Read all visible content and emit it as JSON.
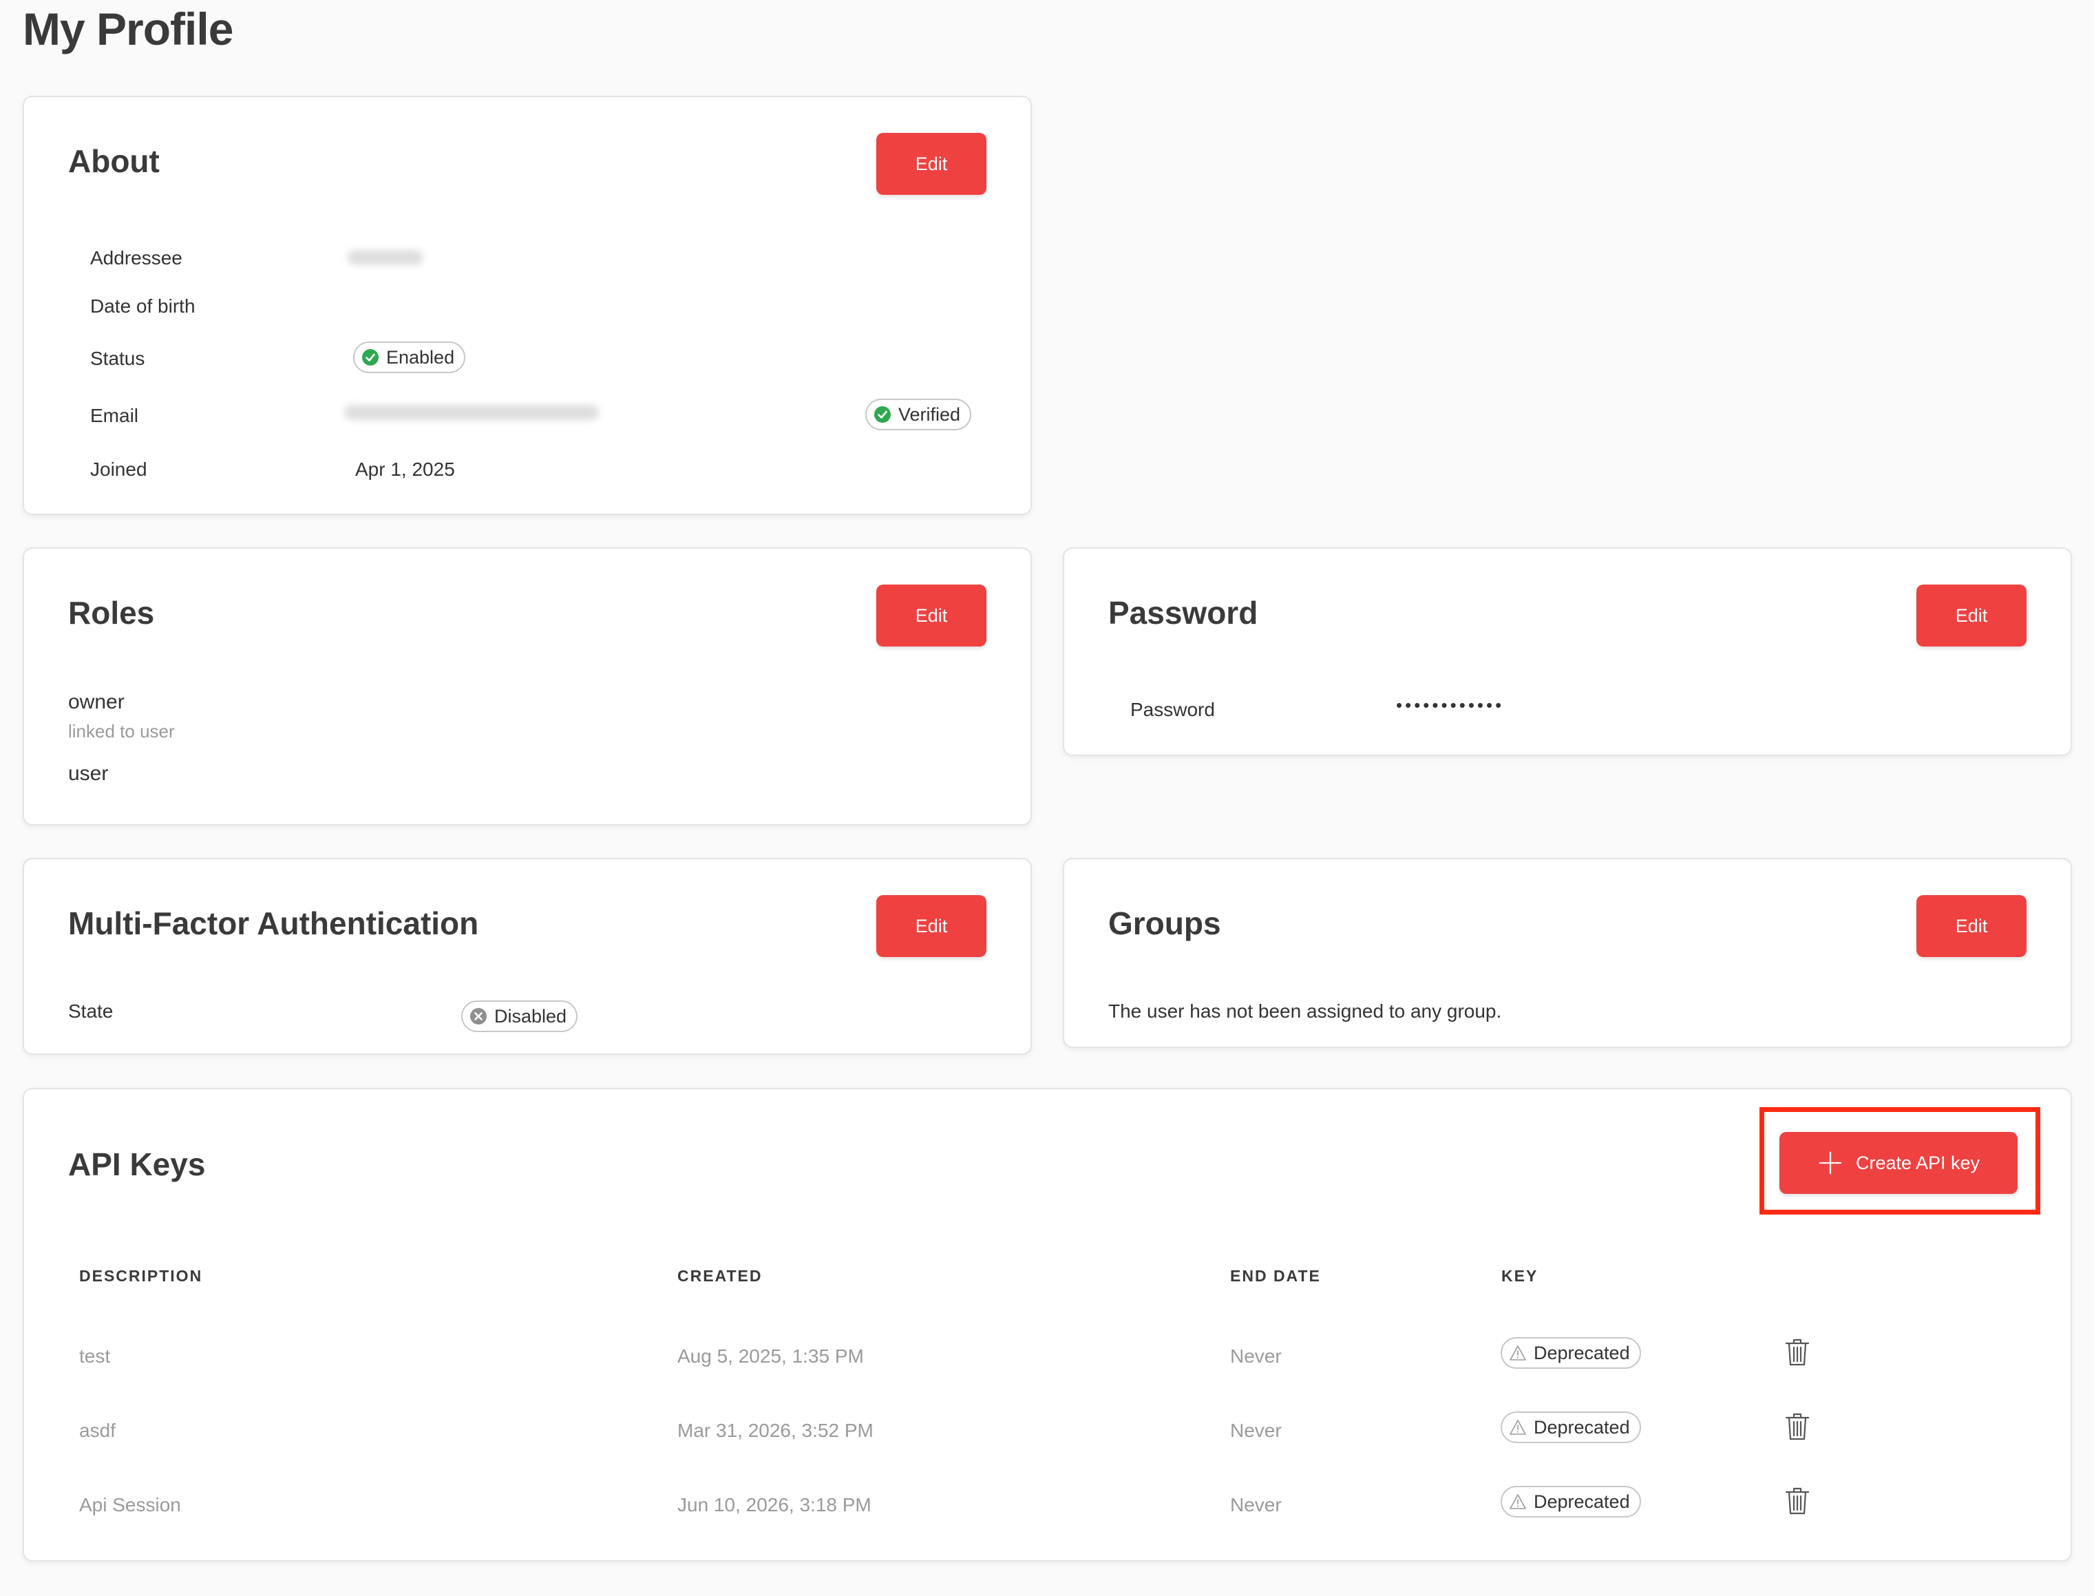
{
  "page": {
    "title": "My Profile"
  },
  "colors": {
    "accent": "#ef4140",
    "success": "#2fa84f",
    "muted": "#9a9a9a"
  },
  "about": {
    "title": "About",
    "edit_label": "Edit",
    "fields": {
      "addressee_label": "Addressee",
      "dob_label": "Date of birth",
      "status_label": "Status",
      "status_value": "Enabled",
      "email_label": "Email",
      "email_status": "Verified",
      "joined_label": "Joined",
      "joined_value": "Apr 1, 2025"
    }
  },
  "roles": {
    "title": "Roles",
    "edit_label": "Edit",
    "items": [
      {
        "name": "owner",
        "sub": "linked to user"
      },
      {
        "name": "user",
        "sub": ""
      }
    ]
  },
  "password": {
    "title": "Password",
    "edit_label": "Edit",
    "label": "Password",
    "value": "••••••••••••"
  },
  "mfa": {
    "title": "Multi-Factor Authentication",
    "edit_label": "Edit",
    "state_label": "State",
    "state_value": "Disabled"
  },
  "groups": {
    "title": "Groups",
    "edit_label": "Edit",
    "empty_text": "The user has not been assigned to any group."
  },
  "api_keys": {
    "title": "API Keys",
    "create_label": "Create API key",
    "columns": [
      "DESCRIPTION",
      "CREATED",
      "END DATE",
      "KEY"
    ],
    "rows": [
      {
        "description": "test",
        "created": "Aug 5, 2025, 1:35 PM",
        "end_date": "Never",
        "key": "Deprecated"
      },
      {
        "description": "asdf",
        "created": "Mar 31, 2026, 3:52 PM",
        "end_date": "Never",
        "key": "Deprecated"
      },
      {
        "description": "Api Session",
        "created": "Jun 10, 2026, 3:18 PM",
        "end_date": "Never",
        "key": "Deprecated"
      }
    ]
  },
  "icons": {
    "check": "check-circle-icon",
    "x": "x-circle-icon",
    "warning": "warning-triangle-icon",
    "trash": "trash-icon",
    "plus": "plus-icon"
  }
}
